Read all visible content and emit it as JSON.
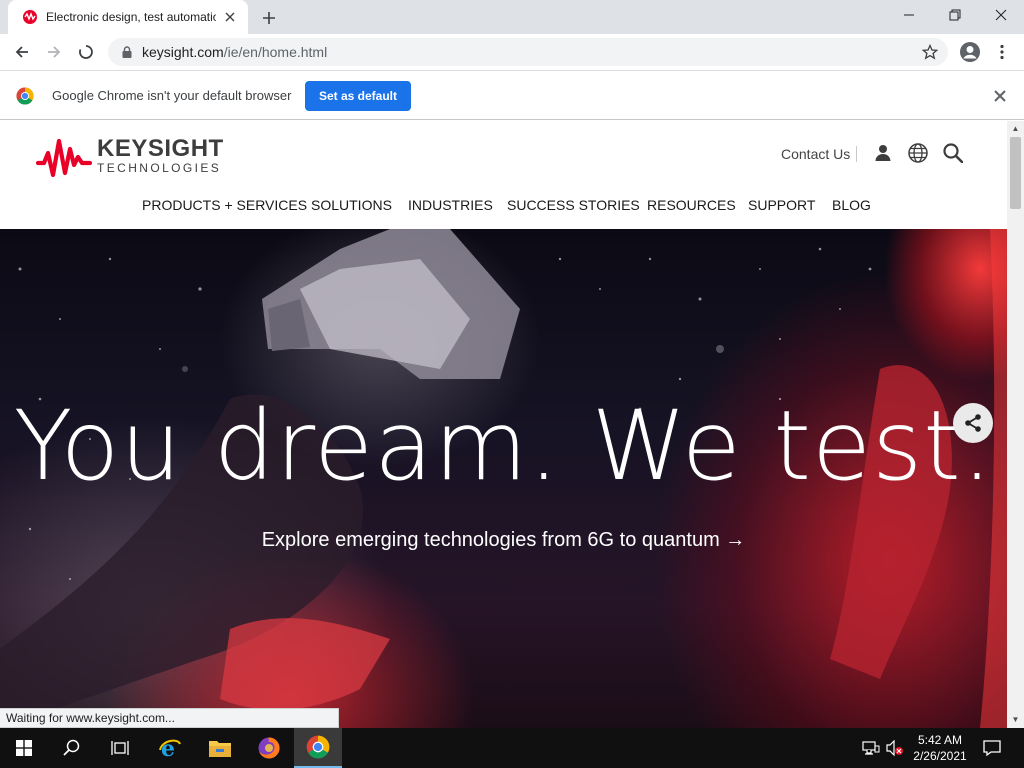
{
  "browser": {
    "tab_title": "Electronic design, test automation",
    "address_host": "keysight.com",
    "address_path": "/ie/en/home.html"
  },
  "infobar": {
    "message": "Google Chrome isn't your default browser",
    "button_label": "Set as default"
  },
  "site": {
    "logo_word": "KEYSIGHT",
    "logo_sub": "TECHNOLOGIES",
    "contact_label": "Contact Us",
    "nav": [
      "PRODUCTS + SERVICES",
      "SOLUTIONS",
      "INDUSTRIES",
      "SUCCESS STORIES",
      "RESOURCES",
      "SUPPORT",
      "BLOG"
    ]
  },
  "hero": {
    "headline": "You dream. We test.",
    "subline": "Explore emerging technologies from 6G to quantum →"
  },
  "status_bar": "Waiting for www.keysight.com...",
  "taskbar": {
    "time": "5:42 AM",
    "date": "2/26/2021"
  },
  "colors": {
    "brand_red": "#e90029",
    "chrome_blue": "#1a73e8"
  }
}
